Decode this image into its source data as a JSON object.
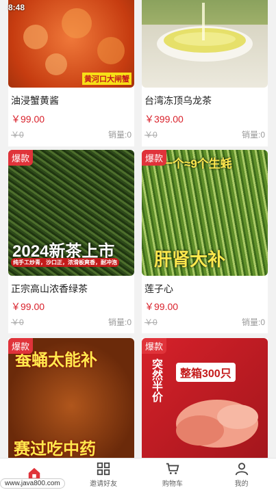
{
  "status": {
    "time": "8:48"
  },
  "products": [
    {
      "name": "油浸蟹黄酱",
      "price": "￥99.00",
      "orig": "￥0",
      "sales": "销量:0",
      "badge": "",
      "img_text": "黄河口大闸蟹"
    },
    {
      "name": "台湾冻顶乌龙茶",
      "price": "￥399.00",
      "orig": "￥0",
      "sales": "销量:0",
      "badge": "",
      "img_text": ""
    },
    {
      "name": "正宗高山浓香绿茶",
      "price": "￥99.00",
      "orig": "￥0",
      "sales": "销量:0",
      "badge": "爆款",
      "img_text": "2024新茶上市",
      "img_sub": "纯手工炒青，沙口正，浓滑板爽香，耐冲泡"
    },
    {
      "name": "莲子心",
      "price": "￥99.00",
      "orig": "￥0",
      "sales": "销量:0",
      "badge": "爆款",
      "img_text": "肝肾大补",
      "img_top": "一个≈9个生蚝"
    },
    {
      "name": "",
      "price": "",
      "orig": "",
      "sales": "",
      "badge": "爆款",
      "img_text": "赛过吃中药",
      "img_top": "蚕蛹太能补"
    },
    {
      "name": "",
      "price": "",
      "orig": "",
      "sales": "",
      "badge": "爆款",
      "img_text": "整箱300只",
      "img_side": "突然半价"
    }
  ],
  "tabbar": [
    {
      "label": "",
      "icon": "home-icon"
    },
    {
      "label": "邀请好友",
      "icon": "grid-icon"
    },
    {
      "label": "购物车",
      "icon": "cart-icon"
    },
    {
      "label": "我的",
      "icon": "user-icon"
    }
  ],
  "watermark": "www.java800.com",
  "colors": {
    "accent": "#d9212b",
    "badge": "#e0333a"
  }
}
